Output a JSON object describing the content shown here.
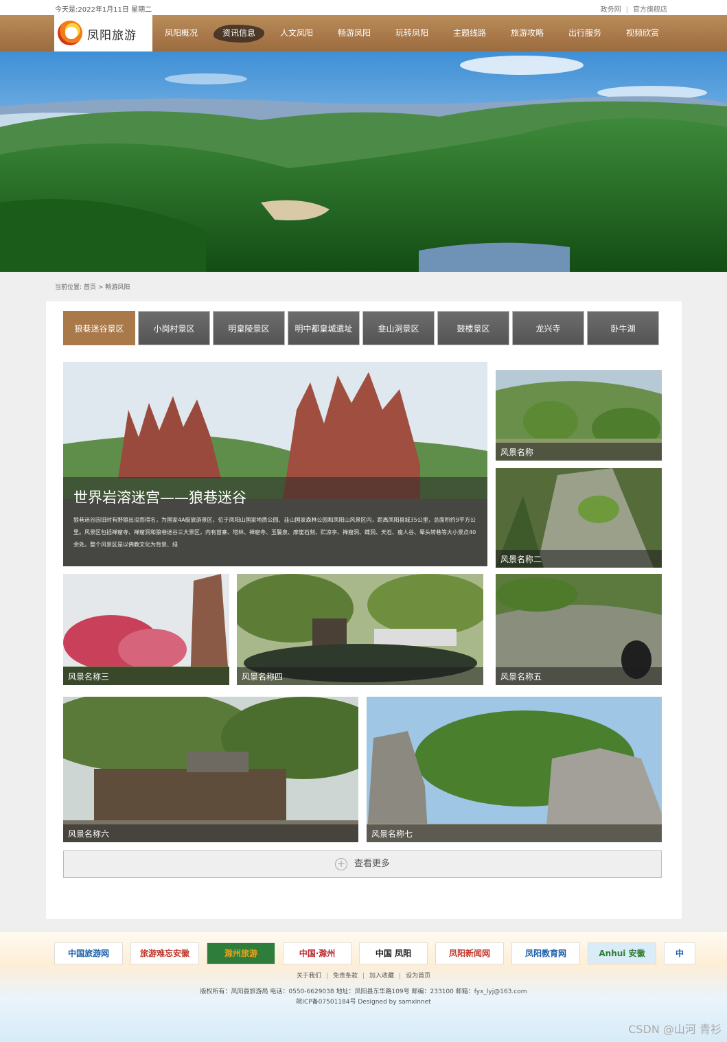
{
  "topbar": {
    "date": "今天是:2022年1月11日 星期二",
    "links": [
      "政务网",
      "官方旗舰店"
    ]
  },
  "logo": {
    "text": "凤阳旅游"
  },
  "nav": {
    "items": [
      "凤阳概况",
      "资讯信息",
      "人文凤阳",
      "畅游凤阳",
      "玩转凤阳",
      "主题线路",
      "旅游攻略",
      "出行服务",
      "视频欣赏"
    ],
    "active_index": 1
  },
  "breadcrumb": {
    "label": "当前位置:",
    "home": "首页",
    "sep": ">",
    "current": "畅游凤阳"
  },
  "tabs": {
    "items": [
      "狼巷迷谷景区",
      "小岗村景区",
      "明皇陵景区",
      "明中都皇城遗址",
      "韭山洞景区",
      "鼓楼景区",
      "龙兴寺",
      "卧牛湖"
    ],
    "active_index": 0
  },
  "feature": {
    "title": "世界岩溶迷宫——狼巷迷谷",
    "desc": "狼巷迷谷因旧时有野狼出没而得名，为国家4A级旅游景区，位于凤阳山国家地质公园、韭山国家森林公园和凤阳山风景区内，距离凤阳县城35公里，总面积约9平方公里。风景区包括禅窟寺、禅窟洞和狼巷迷谷三大景区，内有苗寨、塔林、禅窟寺、玉鬟泉、摩崖石刻、贮凉亭、禅窟洞、蝶洞、天石、瘦人谷、晕头转巷等大小景点40余处。整个风景区是以佛教文化为背景、绿"
  },
  "tiles": [
    "风景名称",
    "风景名称二",
    "风景名称三",
    "风景名称四",
    "风景名称五",
    "风景名称六",
    "风景名称七"
  ],
  "more": {
    "label": "查看更多"
  },
  "footer": {
    "friend_links": [
      "中国旅游网",
      "旅游难忘安徽",
      "滁州旅游",
      "中国·滁州",
      "中国 凤阳",
      "凤阳新闻网",
      "凤阳教育网",
      "Anhui 安徽",
      "中"
    ],
    "links": [
      "关于我们",
      "免责条款",
      "加入收藏",
      "设为首页"
    ],
    "copyright": "版权所有：凤阳县旅游局 电话：0550-6629038 地址：凤阳县东华路109号 邮编：233100 邮箱：fyx_lyj@163.com",
    "icp": "皖ICP备07501184号 Designed by samxinnet"
  },
  "watermark": "CSDN @山河 青衫",
  "colors": {
    "accent": "#a9794a",
    "tab_inactive": "#5f5f5f",
    "nav_active": "#3b2d22"
  }
}
